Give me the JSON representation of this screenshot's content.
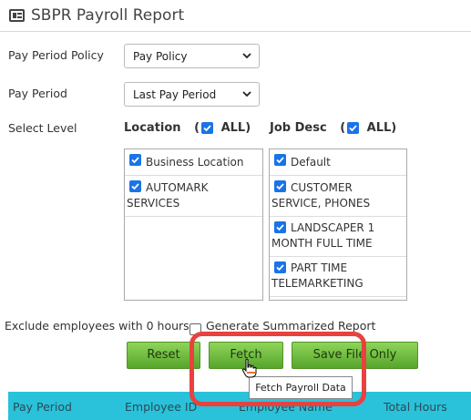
{
  "header": {
    "title": "SBPR Payroll Report",
    "icon": "report-icon"
  },
  "form": {
    "pay_period_policy_label": "Pay Period Policy",
    "pay_period_policy_value": "Pay Policy",
    "pay_period_label": "Pay Period",
    "pay_period_value": "Last Pay Period",
    "select_level_label": "Select Level"
  },
  "location": {
    "header": "Location",
    "all_label": "ALL)",
    "paren": "(",
    "items": [
      {
        "label": "Business Location",
        "checked": true
      },
      {
        "label": "AUTOMARK",
        "label2": "SERVICES",
        "checked": true
      }
    ]
  },
  "job_desc": {
    "header": "Job Desc",
    "all_label": "ALL)",
    "paren": "(",
    "items": [
      {
        "label": "Default",
        "checked": true
      },
      {
        "label": "CUSTOMER",
        "label2": "SERVICE, PHONES",
        "checked": true
      },
      {
        "label": "LANDSCAPER 1",
        "label2": "MONTH FULL TIME",
        "checked": true
      },
      {
        "label": "PART TIME",
        "label2": "TELEMARKETING",
        "checked": true
      }
    ]
  },
  "options": {
    "exclude_label": "Exclude employees with 0 hours",
    "summarized_label": "Generate Summarized Report",
    "summarized_checked": false
  },
  "buttons": {
    "reset": "Reset",
    "fetch": "Fetch",
    "save": "Save File Only"
  },
  "tooltip": "Fetch Payroll Data",
  "table": {
    "headers": [
      "Pay Period",
      "Employee ID",
      "Employee Name",
      "Total Hours"
    ]
  },
  "colors": {
    "accent": "#29c2da",
    "button": "#6cbf3a",
    "highlight": "#e8413f",
    "checkbox": "#1a73e8"
  }
}
